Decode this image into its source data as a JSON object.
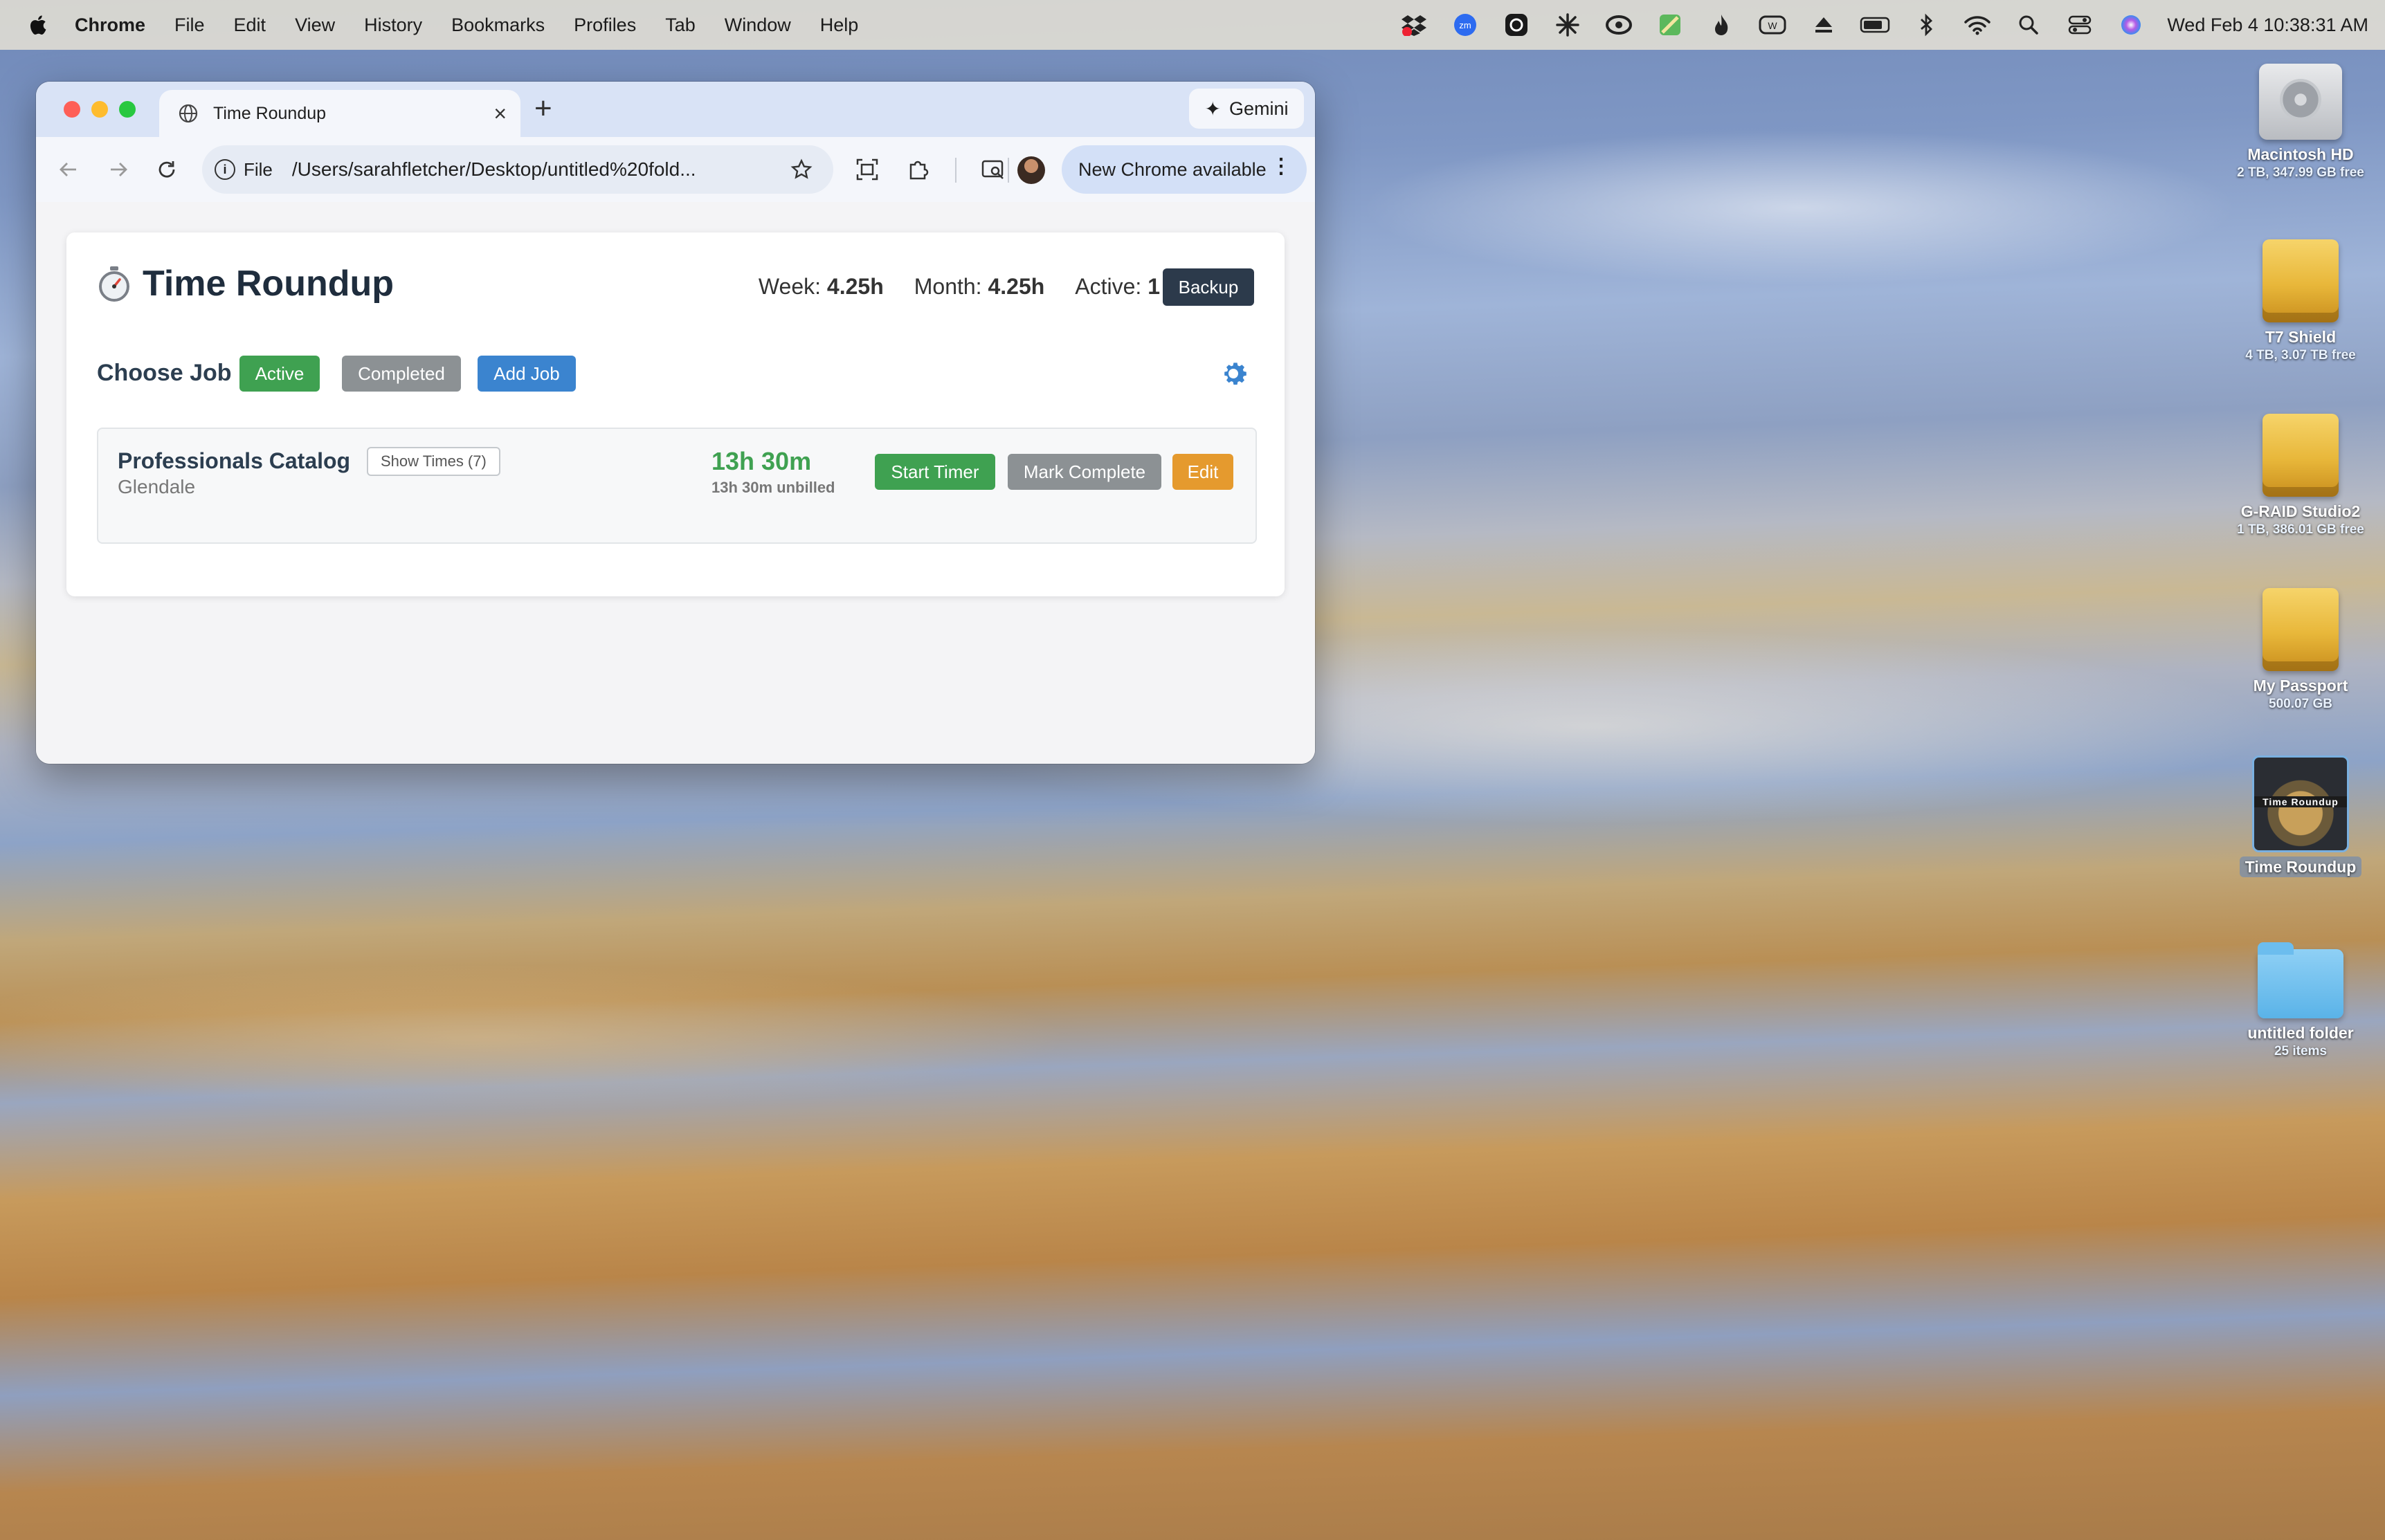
{
  "menubar": {
    "app": "Chrome",
    "items": [
      "File",
      "Edit",
      "View",
      "History",
      "Bookmarks",
      "Profiles",
      "Tab",
      "Window",
      "Help"
    ],
    "clock": "Wed Feb 4  10:38:31 AM",
    "status_icons": [
      "dropbox-icon",
      "zoom-icon",
      "chatgpt-icon",
      "claude-icon",
      "creative-cloud-icon",
      "maps-icon",
      "flame-icon",
      "webex-icon",
      "eject-icon",
      "battery-icon",
      "bluetooth-icon",
      "wifi-icon",
      "spotlight-search-icon",
      "control-center-icon",
      "siri-icon"
    ]
  },
  "browser": {
    "tab_title": "Time Roundup",
    "gemini_label": "Gemini",
    "omnibox_chip": "File",
    "url": "/Users/sarahfletcher/Desktop/untitled%20fold...",
    "update_label": "New Chrome available"
  },
  "app": {
    "title": "Time Roundup",
    "stats": {
      "week_label": "Week:",
      "week_value": "4.25h",
      "month_label": "Month:",
      "month_value": "4.25h",
      "active_label": "Active:",
      "active_value": "1"
    },
    "backup_label": "Backup",
    "choose_label": "Choose Job",
    "filter_active": "Active",
    "filter_completed": "Completed",
    "add_job": "Add Job",
    "jobs": [
      {
        "name": "Professionals Catalog",
        "show_times": "Show Times (7)",
        "location": "Glendale",
        "hours": "13h 30m",
        "unbilled": "13h 30m unbilled",
        "start": "Start Timer",
        "complete": "Mark Complete",
        "edit": "Edit"
      }
    ]
  },
  "desktop": {
    "icons": [
      {
        "label": "Macintosh HD",
        "sub": "2 TB, 347.99 GB free"
      },
      {
        "label": "T7 Shield",
        "sub": "4 TB, 3.07 TB free"
      },
      {
        "label": "G-RAID Studio2",
        "sub": "1 TB, 386.01 GB free"
      },
      {
        "label": "My Passport",
        "sub": "500.07 GB"
      },
      {
        "label": "Time Roundup",
        "sub": ""
      },
      {
        "label": "untitled folder",
        "sub": "25 items"
      }
    ],
    "app_icon_text": "Time Roundup"
  }
}
